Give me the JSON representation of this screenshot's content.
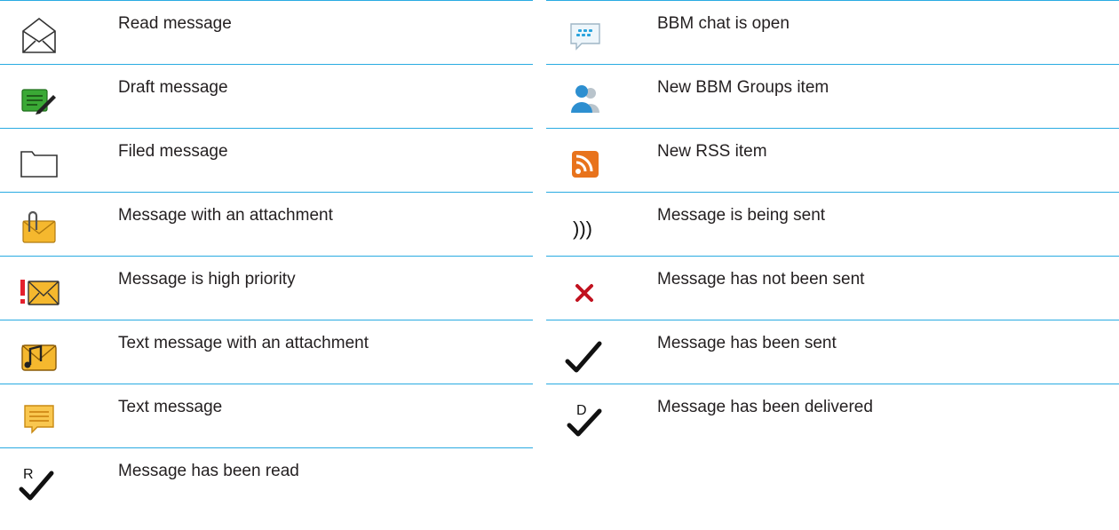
{
  "left_column": {
    "rows": [
      {
        "icon": "read-message-icon",
        "label": "Read message"
      },
      {
        "icon": "draft-message-icon",
        "label": "Draft message"
      },
      {
        "icon": "filed-message-icon",
        "label": "Filed message"
      },
      {
        "icon": "attachment-message-icon",
        "label": "Message with an attachment"
      },
      {
        "icon": "high-priority-message-icon",
        "label": "Message is high priority"
      },
      {
        "icon": "text-message-attachment-icon",
        "label": "Text message with an attachment"
      },
      {
        "icon": "text-message-icon",
        "label": "Text message"
      },
      {
        "icon": "message-read-check-icon",
        "label": "Message has been read",
        "glyph": "R"
      }
    ]
  },
  "right_column": {
    "rows": [
      {
        "icon": "bbm-chat-icon",
        "label": "BBM chat is open"
      },
      {
        "icon": "bbm-groups-icon",
        "label": "New BBM Groups item"
      },
      {
        "icon": "rss-icon",
        "label": "New RSS item"
      },
      {
        "icon": "sending-icon",
        "label": "Message is being sent",
        "glyph": ")))"
      },
      {
        "icon": "not-sent-x-icon",
        "label": "Message has not been sent"
      },
      {
        "icon": "sent-check-icon",
        "label": "Message has been sent"
      },
      {
        "icon": "delivered-check-icon",
        "label": "Message has been delivered",
        "glyph": "D"
      }
    ]
  },
  "colors": {
    "rule": "#29abe2",
    "text": "#231f20",
    "error": "#c1121f",
    "envelope": "#f5b82e"
  }
}
